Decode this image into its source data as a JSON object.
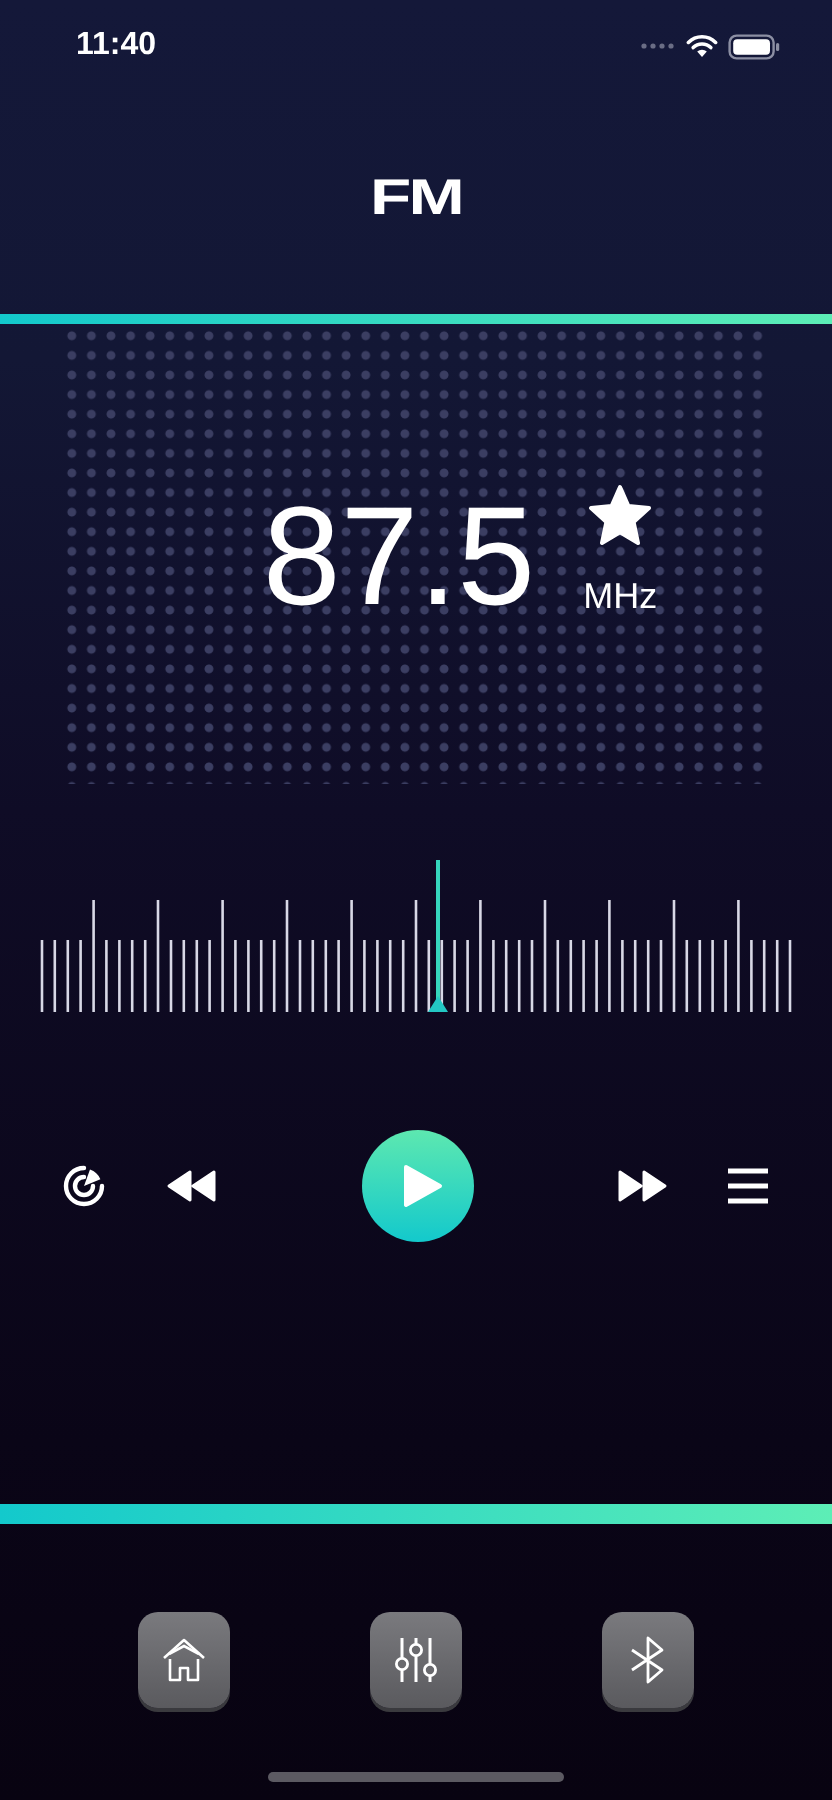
{
  "status_bar": {
    "time": "11:40"
  },
  "title": "FM",
  "display": {
    "frequency": "87.5",
    "unit": "MHz",
    "favorite": true
  },
  "controls": [
    {
      "kind": "scan"
    },
    {
      "kind": "rewind"
    },
    {
      "kind": "play"
    },
    {
      "kind": "forward"
    },
    {
      "kind": "list"
    }
  ],
  "bottom_buttons": [
    {
      "kind": "home"
    },
    {
      "kind": "equalizer"
    },
    {
      "kind": "bluetooth"
    }
  ]
}
